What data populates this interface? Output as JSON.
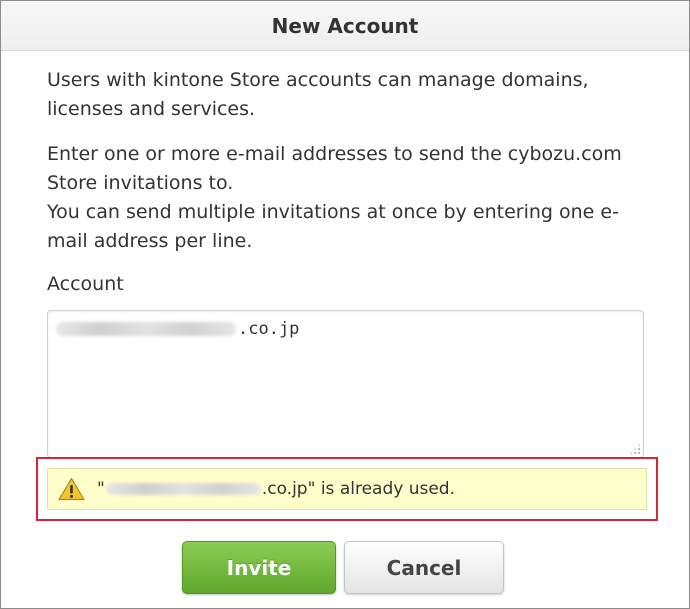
{
  "dialog": {
    "title": "New Account",
    "paragraph1": "Users with kintone Store accounts can manage domains, licenses and services.",
    "paragraph2_line1": "Enter one or more e-mail addresses to send the cybozu.com Store invitations to.",
    "paragraph2_line2": "You can send multiple invitations at once by entering one e-mail address per line."
  },
  "account": {
    "label": "Account",
    "value_suffix": ".co.jp"
  },
  "error": {
    "icon": "warning-icon",
    "quote_open": "\"",
    "domain_suffix": ".co.jp",
    "message_tail": "\" is already used."
  },
  "buttons": {
    "invite_label": "Invite",
    "cancel_label": "Cancel"
  },
  "colors": {
    "invite_green": "#6cb434",
    "error_highlight": "#d7243b",
    "error_background": "#ffffcc"
  }
}
